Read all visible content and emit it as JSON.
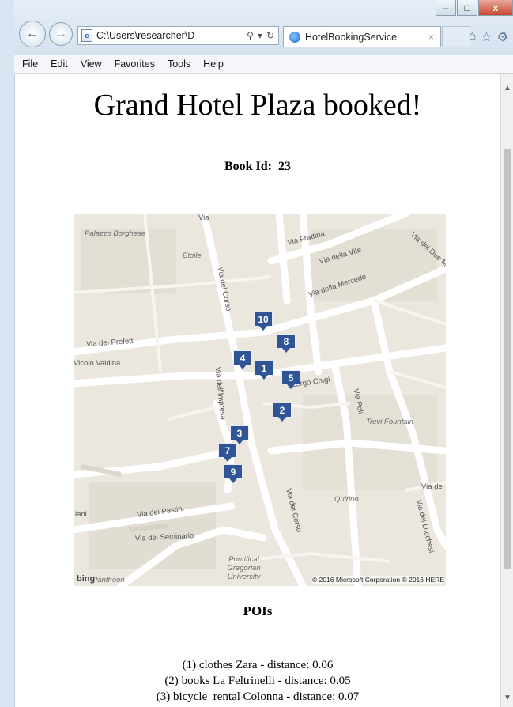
{
  "browser": {
    "address": "C:\\Users\\researcher\\D",
    "tab_title": "HotelBookingService",
    "tab_close": "×",
    "window_buttons": {
      "minimize": "–",
      "maximize": "□",
      "close": "x"
    }
  },
  "menu": [
    "File",
    "Edit",
    "View",
    "Favorites",
    "Tools",
    "Help"
  ],
  "page": {
    "title": "Grand Hotel Plaza booked!",
    "book_id_label": "Book Id:",
    "book_id": "23",
    "pois_heading": "POIs"
  },
  "map": {
    "streets": [
      "Via Frattina",
      "Via della Vite",
      "Via della Mercede",
      "Via dei Prefetti",
      "Vicolo Valdina",
      "Via del Corso",
      "Via dell'Impresa",
      "Via dei Pastini",
      "Via del Seminario",
      "Via del Corso",
      "Via dei Due M",
      "Via Poli",
      "Via de",
      "Via dei Lucchesi",
      "Largo Chigi",
      "Via"
    ],
    "places": [
      "Palazzo Borghese",
      "Etoile",
      "Trevi Fountain",
      "Quirino",
      "Pontifical Gregorian University",
      "iani",
      "Pantheon"
    ],
    "attribution_logo": "bing",
    "copyright": "© 2016 Microsoft Corporation © 2016 HERE",
    "markers": [
      "10",
      "8",
      "4",
      "1",
      "5",
      "2",
      "3",
      "7",
      "9"
    ]
  },
  "pois": [
    {
      "index": "(1)",
      "text": "clothes Zara - distance: 0.06"
    },
    {
      "index": "(2)",
      "text": "books La Feltrinelli - distance: 0.05"
    },
    {
      "index": "(3)",
      "text": "bicycle_rental Colonna - distance: 0.07"
    }
  ]
}
